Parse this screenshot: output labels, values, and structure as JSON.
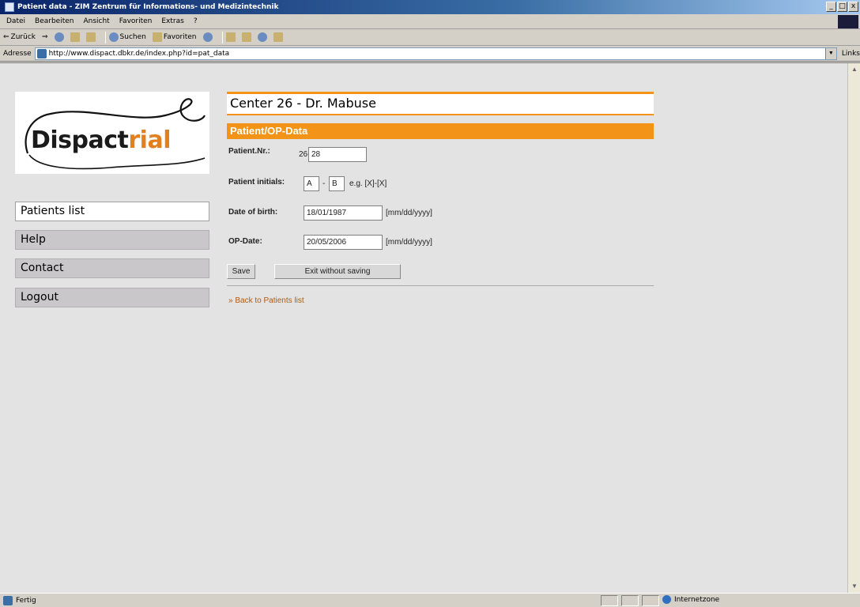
{
  "window": {
    "title": "Patient data - ZIM Zentrum für Informations- und Medizintechnik",
    "buttons": [
      "_",
      "□",
      "x"
    ]
  },
  "menu": [
    "Datei",
    "Bearbeiten",
    "Ansicht",
    "Favoriten",
    "Extras",
    "?"
  ],
  "toolbar": {
    "back": "Zurück",
    "search": "Suchen",
    "favorites": "Favoriten"
  },
  "address": {
    "label": "Adresse",
    "url": "http://www.dispact.dbkr.de/index.php?id=pat_data",
    "links": "Links"
  },
  "logo": {
    "text_main": "Dispact",
    "text_accent": "rial",
    "accent_color": "#e27f1e"
  },
  "nav": [
    {
      "label": "Patients list"
    },
    {
      "label": "Help"
    },
    {
      "label": "Contact"
    },
    {
      "label": "Logout"
    }
  ],
  "center_title": "Center 26 - Dr. Mabuse",
  "section_title": "Patient/OP-Data",
  "form": {
    "patient_nr_label": "Patient.Nr.:",
    "patient_nr_prefix": "26-",
    "patient_nr_value": "28",
    "initials_label": "Patient initials:",
    "initial_first": "A",
    "initial_sep": "-",
    "initial_second": "B",
    "initials_hint": "e.g. [X]-[X]",
    "dob_label": "Date of birth:",
    "dob_value": "18/01/1987",
    "dob_hint": "[mm/dd/yyyy]",
    "op_label": "OP-Date:",
    "op_value": "20/05/2006",
    "op_hint": "[mm/dd/yyyy]",
    "save_label": "Save",
    "exit_label": "Exit without saving",
    "back_link": "» Back to Patients list"
  },
  "status": {
    "left": "Fertig",
    "zone": "Internetzone"
  },
  "colors": {
    "accent": "#f39418",
    "nav_inactive": "#c9c7c9",
    "page_bg": "#e3e3e3"
  }
}
